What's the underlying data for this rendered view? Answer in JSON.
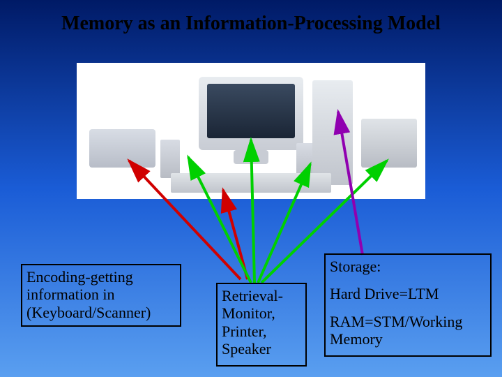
{
  "title": "Memory as an Information-Processing Model",
  "encoding": {
    "line1": "Encoding-getting",
    "line2": "information in",
    "line3": "(Keyboard/Scanner)"
  },
  "retrieval": {
    "line1": "Retrieval-",
    "line2": "Monitor,",
    "line3": "Printer,",
    "line4": "Speaker"
  },
  "storage": {
    "line1": "Storage:",
    "line2": "Hard Drive=LTM",
    "line3": "RAM=STM/Working",
    "line4": "Memory"
  },
  "colors": {
    "arrow_green": "#00d000",
    "arrow_red": "#d00000",
    "arrow_purple": "#9000b0"
  }
}
